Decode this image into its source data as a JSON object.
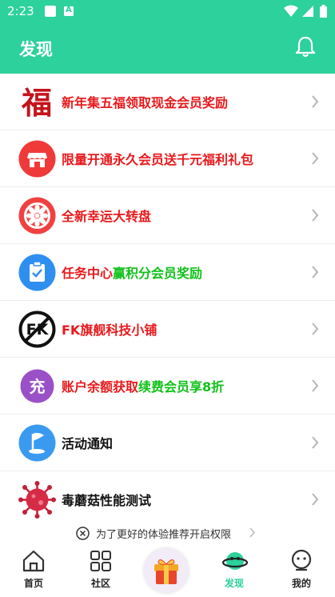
{
  "status": {
    "time": "2:23"
  },
  "header": {
    "title": "发现"
  },
  "items": [
    {
      "parts": [
        {
          "text": "新年集五福领取现金会员奖励",
          "color": "red"
        }
      ],
      "icon": "fu-icon"
    },
    {
      "parts": [
        {
          "text": "限量开通永久会员送千元福利礼包",
          "color": "red"
        }
      ],
      "icon": "shop-icon"
    },
    {
      "parts": [
        {
          "text": "全新幸运大转盘",
          "color": "red"
        }
      ],
      "icon": "wheel-icon"
    },
    {
      "parts": [
        {
          "text": "任务中心",
          "color": "red"
        },
        {
          "text": "赢积分会员奖励",
          "color": "green"
        }
      ],
      "icon": "task-icon"
    },
    {
      "parts": [
        {
          "text": "FK旗舰科技小铺",
          "color": "red"
        }
      ],
      "icon": "fk-logo-icon"
    },
    {
      "parts": [
        {
          "text": "账户余额获取",
          "color": "red"
        },
        {
          "text": "续费会员享8折",
          "color": "green"
        }
      ],
      "icon": "recharge-icon"
    },
    {
      "parts": [
        {
          "text": "活动通知",
          "color": "black"
        }
      ],
      "icon": "flag-icon"
    },
    {
      "parts": [
        {
          "text": "毒蘑菇性能测试",
          "color": "black"
        }
      ],
      "icon": "virus-icon"
    }
  ],
  "notice": {
    "text": "为了更好的体验推荐开启权限"
  },
  "fu_char": "福",
  "recharge_char": "充",
  "fk_text": "FK",
  "tabs": [
    {
      "label": "首页"
    },
    {
      "label": "社区"
    },
    {
      "label": "发现"
    },
    {
      "label": "我的"
    }
  ],
  "colors": {
    "primary": "#2dd19b",
    "red": "#e8191c",
    "green": "#11c21a"
  }
}
